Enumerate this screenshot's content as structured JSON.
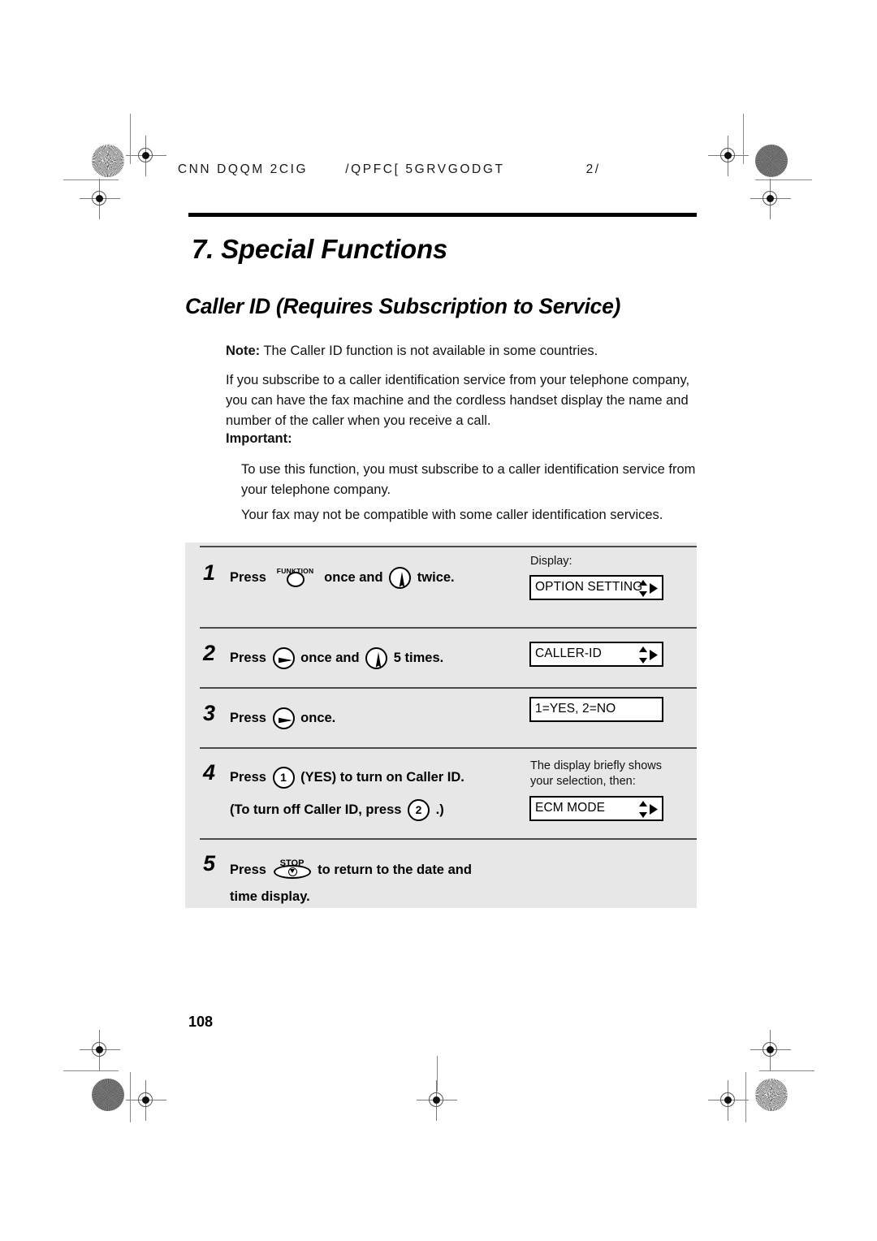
{
  "header": {
    "left_text": "CNN DQQM 2CIG",
    "middle_text": "/QPFC[ 5GRVGODGT",
    "right_text": "2/"
  },
  "chapter": {
    "number_title": "7.  Special Functions",
    "section_title": "Caller ID (Requires Subscription to Service)"
  },
  "body": {
    "note_label": "Note:",
    "note_text": " The Caller ID function is not available in some countries.",
    "intro": "If you subscribe to a caller identification service from your telephone company, you can have the fax machine and the cordless handset display the name and number of the caller when you receive a call.",
    "important_label": "Important:",
    "important_1": "To use this function, you must subscribe to a caller identification service from your telephone company.",
    "important_2": "Your fax may not be compatible with some caller identification services."
  },
  "steps": [
    {
      "number": "1",
      "press_label": "Press",
      "key_1": "FUNKTION",
      "mid_text": "once and",
      "key_2": "down-arrow",
      "end_text": "twice.",
      "display_label": "Display:",
      "lcd_text": "OPTION SETTING",
      "lcd_arrows": "up-down-right"
    },
    {
      "number": "2",
      "press_label": "Press",
      "key_1": "right-arrow",
      "mid_text": "once and",
      "key_2": "down-arrow",
      "end_text": "5 times.",
      "lcd_text": "CALLER-ID",
      "lcd_arrows": "up-down-right"
    },
    {
      "number": "3",
      "press_label": "Press",
      "key_1": "right-arrow",
      "end_text": "once.",
      "lcd_text": "1=YES, 2=NO",
      "lcd_arrows": "none"
    },
    {
      "number": "4",
      "press_label": "Press",
      "key_1": "1",
      "mid_text": "(YES) to turn on Caller ID.",
      "line2_pre": "(To turn off Caller ID, press",
      "key_2": "2",
      "line2_post": ".)",
      "display_label": "The display briefly shows your selection, then:",
      "lcd_text": "ECM MODE",
      "lcd_arrows": "up-down-right"
    },
    {
      "number": "5",
      "press_label": "Press",
      "key_1": "STOP",
      "mid_text": "to return to the date and",
      "line2": "time display."
    }
  ],
  "folio": "108",
  "colors": {
    "panel_bg": "#e7e7e7",
    "rule": "#000000",
    "text": "#111111"
  }
}
